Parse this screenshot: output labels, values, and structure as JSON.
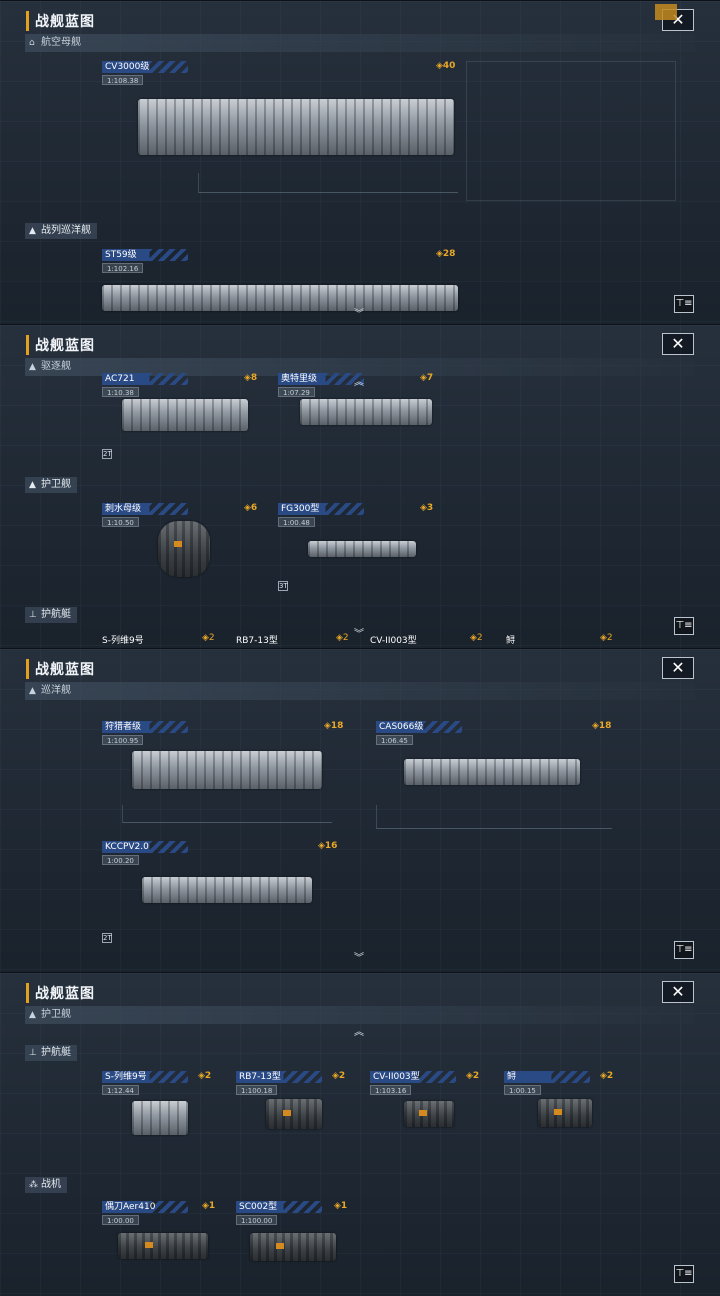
{
  "title": "战舰蓝图",
  "close_glyph": "✕",
  "filter_glyph": "⊤≡",
  "chevron_down": "︾",
  "chevron_up": "︽",
  "points_glyph": "◈",
  "panel1": {
    "section_top": "航空母舰",
    "section_mid": "战列巡洋舰",
    "cards": [
      {
        "name": "CV3000级",
        "scale": "1:108.38",
        "points": "40"
      },
      {
        "name": "ST59级",
        "scale": "1:102.16",
        "points": "28"
      }
    ]
  },
  "panel2": {
    "section_top": "驱逐舰",
    "section_mid": "护卫舰",
    "section_bottom": "护航艇",
    "cards_top": [
      {
        "name": "AC721",
        "scale": "1:10.38",
        "points": "8"
      },
      {
        "name": "奥特里级",
        "scale": "1:07.29",
        "points": "7"
      }
    ],
    "cards_mid": [
      {
        "name": "刺水母级",
        "scale": "1:10.50",
        "points": "6"
      },
      {
        "name": "FG300型",
        "scale": "1:00.48",
        "points": "3"
      }
    ],
    "badges": [
      "2T",
      "3T"
    ],
    "peek": [
      {
        "name": "S-列维9号",
        "points": "2"
      },
      {
        "name": "RB7-13型",
        "points": "2"
      },
      {
        "name": "CV-II003型",
        "points": "2"
      },
      {
        "name": "鲟",
        "points": "2"
      }
    ]
  },
  "panel3": {
    "section_top": "巡洋舰",
    "cards": [
      {
        "name": "狩猎者级",
        "scale": "1:100.95",
        "points": "18"
      },
      {
        "name": "CAS066级",
        "scale": "1:06.45",
        "points": "18"
      },
      {
        "name": "KCCPV2.0",
        "scale": "1:00.20",
        "points": "16"
      }
    ],
    "badge": "2T"
  },
  "panel4": {
    "section_top": "护卫舰",
    "section_mid": "护航艇",
    "section_bottom": "战机",
    "escorts": [
      {
        "name": "S-列维9号",
        "scale": "1:12.44",
        "points": "2"
      },
      {
        "name": "RB7-13型",
        "scale": "1:100.18",
        "points": "2"
      },
      {
        "name": "CV-II003型",
        "scale": "1:103.16",
        "points": "2"
      },
      {
        "name": "鲟",
        "scale": "1:00.15",
        "points": "2"
      }
    ],
    "fighters": [
      {
        "name": "偶刀Aer410",
        "scale": "1:00.00",
        "points": "1"
      },
      {
        "name": "SC002型",
        "scale": "1:100.00",
        "points": "1"
      }
    ]
  }
}
